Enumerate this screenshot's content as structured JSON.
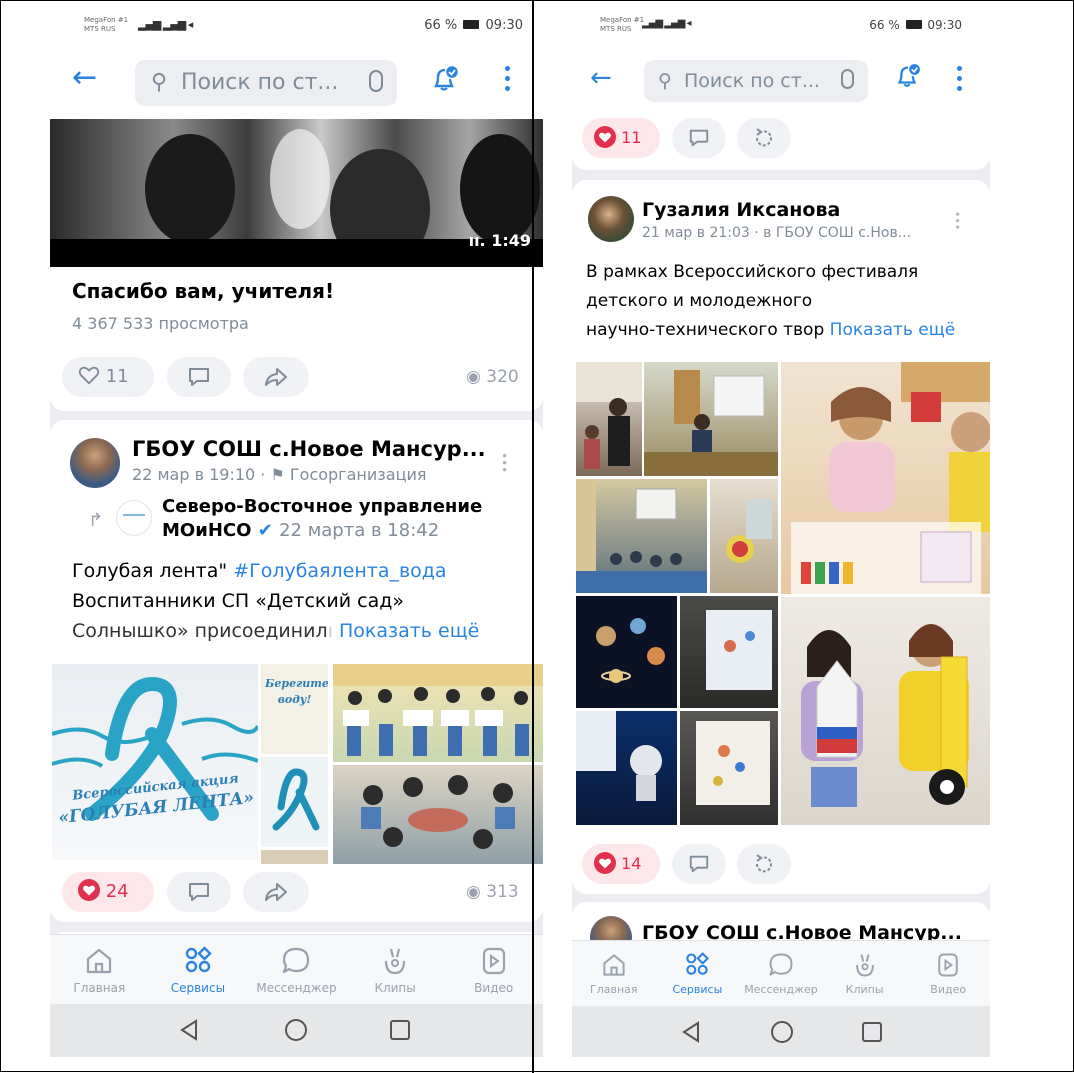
{
  "status": {
    "carrier1": "MegaFon #1",
    "carrier2": "MTS RUS",
    "battery": "66 %",
    "time": "09:30"
  },
  "topbar": {
    "search_placeholder": "Поиск по ст..."
  },
  "left": {
    "video": {
      "duration": "1:49",
      "title": "Спасибо вам, учителя!",
      "views_text": "4 367 533 просмотра",
      "likes": "11",
      "eye_count": "320"
    },
    "post": {
      "author": "ГБОУ СОШ с.Новое Мансур...",
      "date": "22 мар в 19:10 · ",
      "org": "Госорганизация",
      "repost_author": "Северо-Восточное управление",
      "repost_author2": "МОиНСО",
      "repost_date": "22 марта в 18:42",
      "text_line1_prefix": "Голубая лента\" ",
      "hashtag": "#Голубаялента_вода",
      "text_line2": "Воспитанники СП «Детский сад»",
      "text_line3": "Солнышко» присоединил",
      "show_more": "Показать ещё",
      "photo_text1": "Берегите",
      "photo_text2": "воду!",
      "photo_text3": "Всероссийская акция",
      "photo_text4": "«ГОЛУБАЯ ЛЕНТА»",
      "likes": "24",
      "eye_count": "313"
    }
  },
  "right": {
    "top_likes": "11",
    "post": {
      "author": "Гузалия Иксанова",
      "date": "21 мар в 21:03 · в ГБОУ СОШ с.Нов...",
      "text_line1": "В рамках Всероссийского фестиваля",
      "text_line2": "детского и молодежного",
      "text_line3": "научно-технического твор",
      "show_more": "Показать ещё",
      "likes": "14"
    },
    "next_post": {
      "author": "ГБОУ СОШ с.Новое Мансур..."
    }
  },
  "tabs": [
    {
      "label": "Главная"
    },
    {
      "label": "Сервисы"
    },
    {
      "label": "Мессенджер"
    },
    {
      "label": "Клипы"
    },
    {
      "label": "Видео"
    }
  ],
  "colors": {
    "accent": "#2a83e0",
    "like": "#e0304e",
    "ribbon": "#2aa4c6"
  }
}
